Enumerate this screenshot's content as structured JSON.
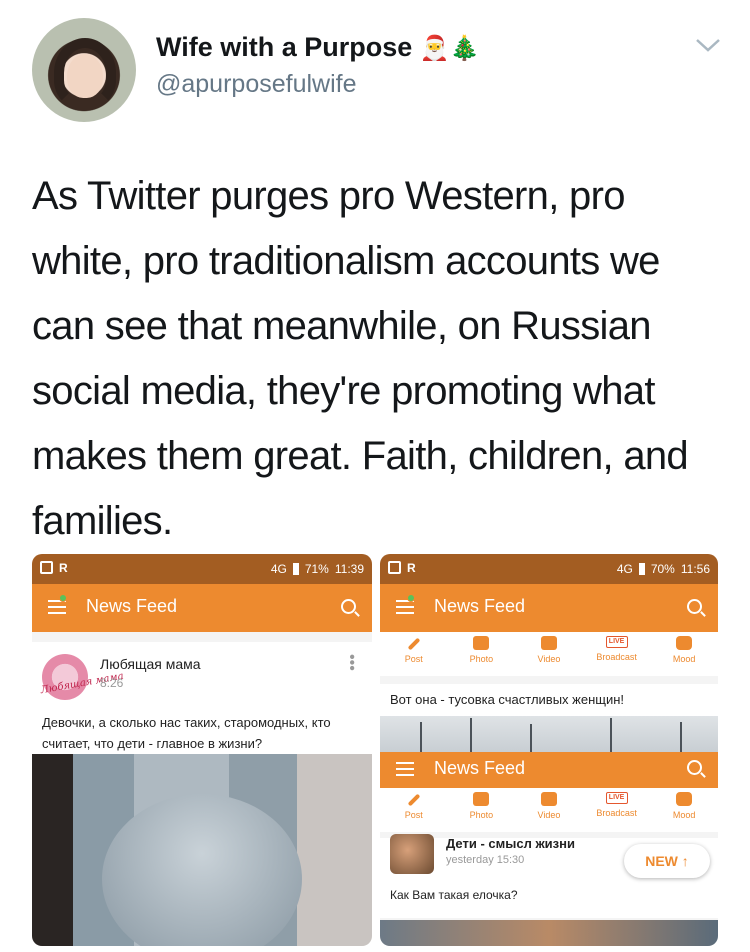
{
  "tweet": {
    "display_name": "Wife with a Purpose",
    "name_emojis": "🎅🎄",
    "handle": "@apurposefulwife",
    "text": "As Twitter purges pro Western, pro white, pro traditionalism accounts we can see that meanwhile, on Russian social media, they're promoting what makes them great. Faith, children, and families."
  },
  "screenshot_left": {
    "status": {
      "network": "4G",
      "battery": "71%",
      "time": "11:39"
    },
    "appbar_title": "News Feed",
    "post": {
      "author": "Любящая мама",
      "time": "8:26",
      "avatar_text": "Любящая мама",
      "text": "Девочки, а сколько нас таких, старомодных, кто считает, что дети - главное в жизни?"
    }
  },
  "screenshot_right": {
    "status": {
      "network": "4G",
      "battery": "70%",
      "time": "11:56"
    },
    "appbar_title": "News Feed",
    "quick_actions": [
      "Post",
      "Photo",
      "Video",
      "Broadcast",
      "Mood"
    ],
    "live_badge": "LIVE",
    "card_text": "Вот она - тусовка счастливых женщин!",
    "post": {
      "title": "Дети - смысл жизни",
      "time": "yesterday 15:30",
      "text": "Как Вам такая елочка?"
    },
    "new_button": "NEW ↑"
  },
  "colors": {
    "accent_orange": "#ed8a2f",
    "status_brown": "#a35d22",
    "handle_gray": "#657786"
  },
  "icons": [
    "chevron-down-icon",
    "menu-icon",
    "search-icon",
    "pen-icon",
    "camera-icon",
    "video-icon",
    "live-icon",
    "mood-icon",
    "battery-icon"
  ]
}
